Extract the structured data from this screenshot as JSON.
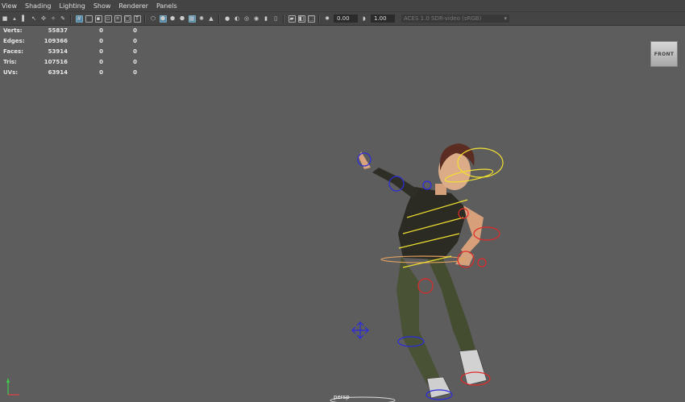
{
  "menu": [
    "View",
    "Shading",
    "Lighting",
    "Show",
    "Renderer",
    "Panels"
  ],
  "toolbar": {
    "exposure": "0.00",
    "gamma": "1.00",
    "color_space": "ACES 1.0 SDR-video (sRGB)"
  },
  "hud": {
    "rows": [
      {
        "label": "Verts:",
        "v1": "55837",
        "v2": "0",
        "v3": "0"
      },
      {
        "label": "Edges:",
        "v1": "109366",
        "v2": "0",
        "v3": "0"
      },
      {
        "label": "Faces:",
        "v1": "53914",
        "v2": "0",
        "v3": "0"
      },
      {
        "label": "Tris:",
        "v1": "107516",
        "v2": "0",
        "v3": "0"
      },
      {
        "label": "UVs:",
        "v1": "63914",
        "v2": "0",
        "v3": "0"
      }
    ]
  },
  "view_cube": {
    "label": "FRONT"
  },
  "camera": {
    "label": "persp"
  },
  "colors": {
    "background": "#5d5d5d",
    "ik_control": "#f2e130",
    "left_control": "#2a2ae0",
    "right_control": "#e02a2a",
    "active": "#5285a6"
  }
}
